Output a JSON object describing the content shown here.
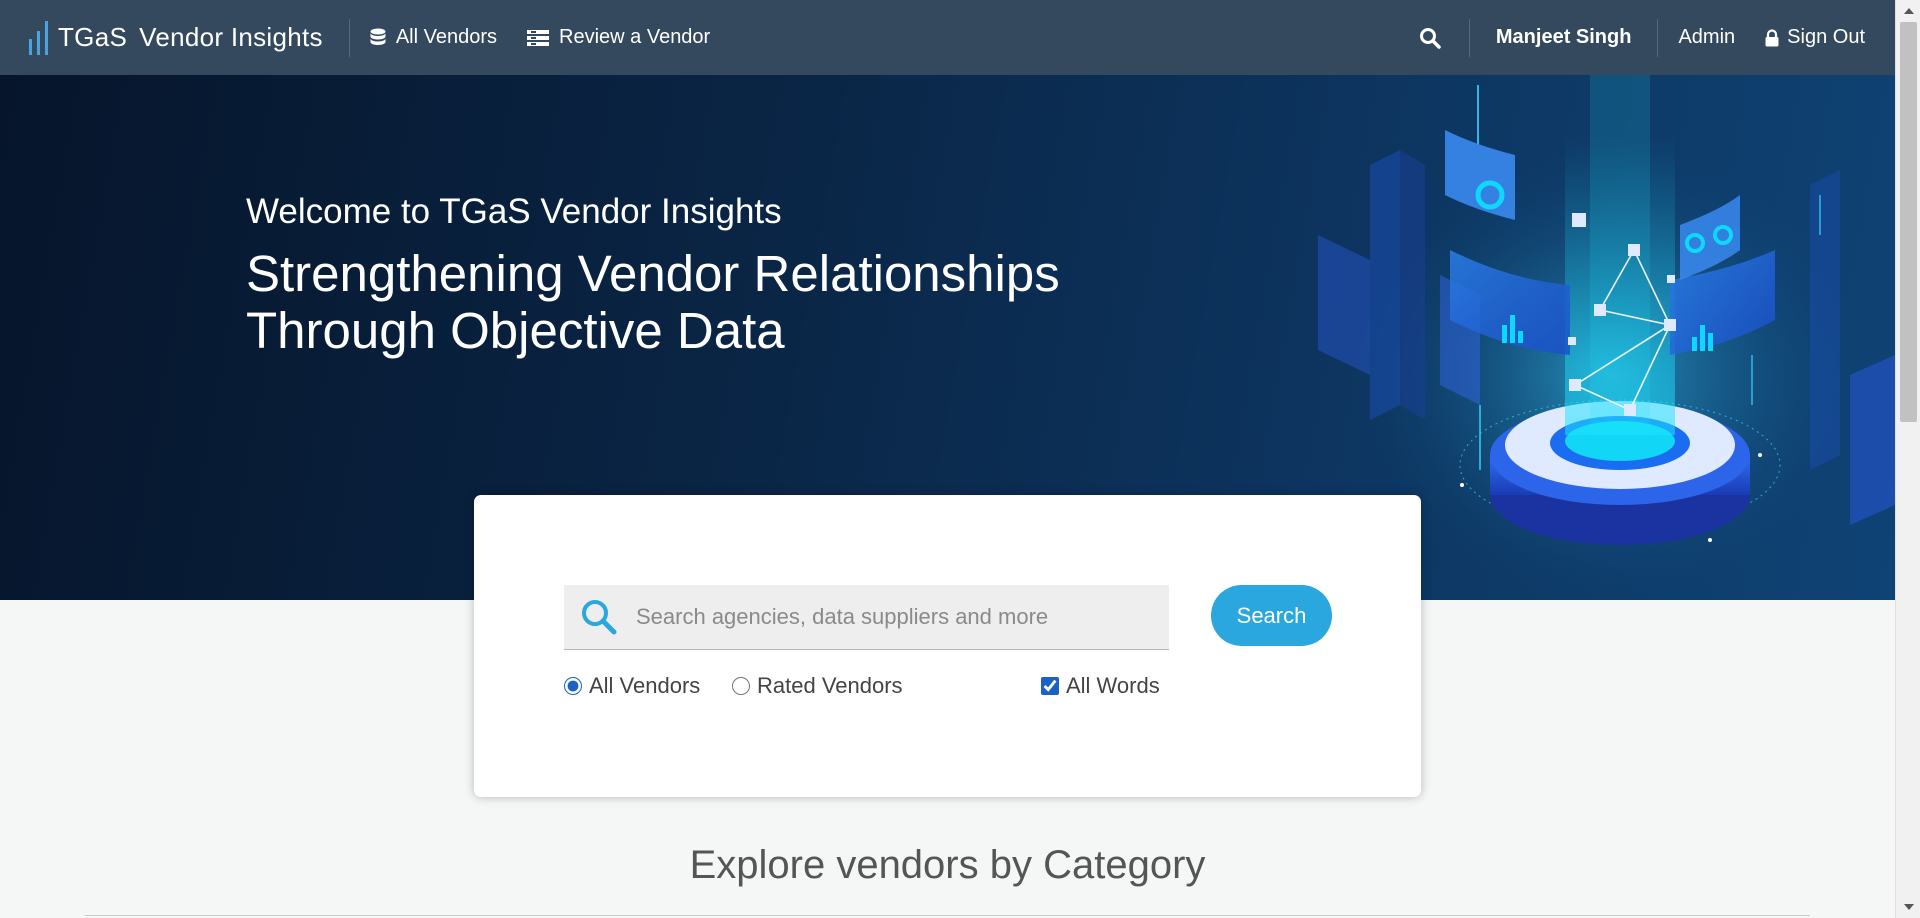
{
  "nav": {
    "brand_part1": "TGaS",
    "brand_part2": "Vendor Insights",
    "all_vendors": "All Vendors",
    "review_vendor": "Review a Vendor",
    "user_name": "Manjeet Singh",
    "admin": "Admin",
    "sign_out": "Sign Out"
  },
  "hero": {
    "welcome": "Welcome to TGaS Vendor Insights",
    "headline_line1": "Strengthening Vendor Relationships",
    "headline_line2": "Through Objective Data"
  },
  "search": {
    "placeholder": "Search agencies, data suppliers and more",
    "button": "Search",
    "option_all_vendors": "All Vendors",
    "option_rated_vendors": "Rated Vendors",
    "option_all_words": "All Words",
    "selected_scope": "All Vendors",
    "all_words_checked": true
  },
  "explore": {
    "title": "Explore vendors by Category"
  },
  "colors": {
    "navbar": "#34495e",
    "hero_dark": "#06152b",
    "accent": "#29a7de",
    "checkbox": "#1a62c5"
  }
}
